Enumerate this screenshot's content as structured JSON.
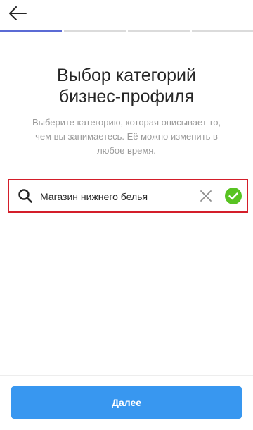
{
  "header": {
    "back_icon": "arrow-left-icon",
    "progress_steps": 4,
    "current_step": 1
  },
  "colors": {
    "accent": "#3897f0",
    "progress_active": "#5b6bd5",
    "progress_inactive": "#dbdbdb",
    "highlight_border": "#d41e2a",
    "check": "#58c322",
    "text_primary": "#262626",
    "text_secondary": "#9a9a9a"
  },
  "title": {
    "line1": "Выбор категорий",
    "line2": "бизнес-профиля"
  },
  "subtitle": {
    "line1": "Выберите категорию, которая описывает то,",
    "line2": "чем вы занимаетесь. Её можно изменить в",
    "line3": "любое время."
  },
  "search": {
    "value": "Магазин нижнего белья",
    "search_icon": "search-icon",
    "clear_icon": "close-icon",
    "confirm_icon": "checkmark-circle-icon"
  },
  "footer": {
    "next_label": "Далее"
  }
}
